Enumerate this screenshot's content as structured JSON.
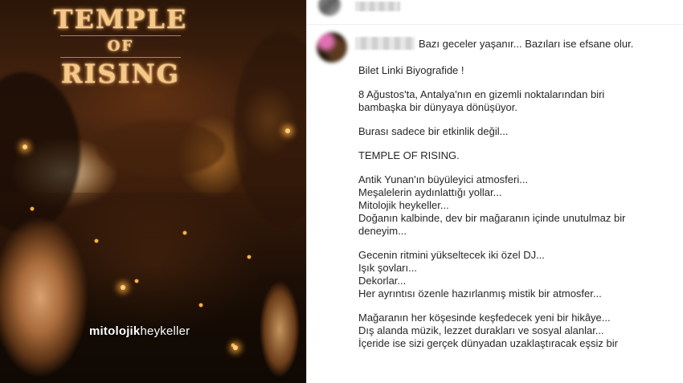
{
  "poster": {
    "title_line1": "TEMPLE",
    "title_line2": "OF",
    "title_line3": "RISING",
    "watermark_bold": "mitolojik",
    "watermark_light": "heykeller"
  },
  "post": {
    "caption_first_line": "Bazı geceler yaşanır... Bazıları ise efsane olur.",
    "caption_paragraphs": [
      [
        "Bilet Linki Biyografide !"
      ],
      [
        "8 Ağustos'ta, Antalya'nın en gizemli noktalarından biri bambaşka bir dünyaya dönüşüyor."
      ],
      [
        "Burası sadece bir etkinlik değil..."
      ],
      [
        "TEMPLE OF RISING."
      ],
      [
        "Antik Yunan'ın büyüleyici atmosferi...",
        "Meşalelerin aydınlattığı yollar...",
        "Mitolojik heykeller...",
        "Doğanın kalbinde, dev bir mağaranın içinde unutulmaz bir deneyim..."
      ],
      [
        "Gecenin ritmini yükseltecek iki özel DJ...",
        "Işık şovları...",
        "Dekorlar...",
        "Her ayrıntısı özenle hazırlanmış mistik bir atmosfer..."
      ],
      [
        "Mağaranın her köşesinde keşfedecek yeni bir hikâye...",
        "Dış alanda müzik, lezzet durakları ve sosyal alanlar...",
        "İçeride ise sizi gerçek dünyadan uzaklaştıracak eşsiz bir"
      ]
    ]
  }
}
